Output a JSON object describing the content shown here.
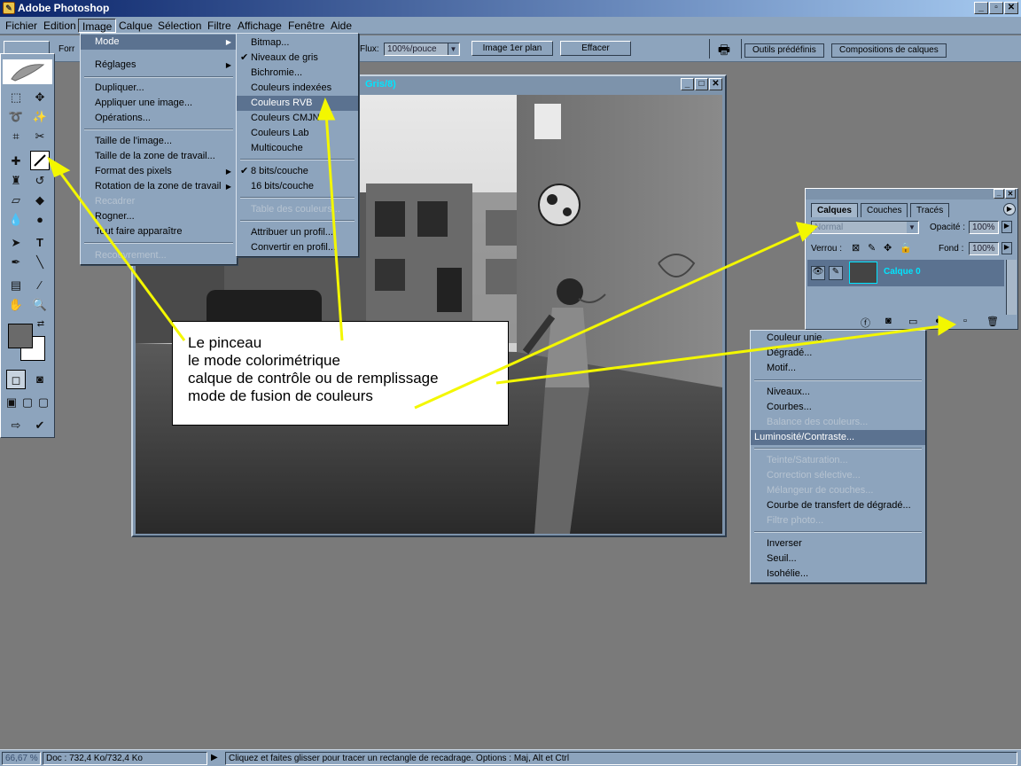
{
  "window": {
    "title": "Adobe Photoshop",
    "controls": [
      "_",
      "▫",
      "✕"
    ]
  },
  "menubar": {
    "items": [
      "Fichier",
      "Edition",
      "Image",
      "Calque",
      "Sélection",
      "Filtre",
      "Affichage",
      "Fenêtre",
      "Aide"
    ],
    "active": "Image"
  },
  "options_bar": {
    "left_label": "Forr",
    "flux_label": "Flux:",
    "flux_value": "100%/pouce",
    "front_image_button": "Image 1er plan",
    "clear_button": "Effacer",
    "palette_tabs": [
      "Outils prédéfinis",
      "Compositions de calques"
    ]
  },
  "document": {
    "title_fragment": "Gris/8)",
    "controls": [
      "_",
      "□",
      "✕"
    ]
  },
  "image_menu": {
    "items": [
      {
        "label": "Mode",
        "submenu": true,
        "highlighted": true
      },
      {
        "label": "Réglages",
        "submenu": true
      },
      {
        "label": "Dupliquer..."
      },
      {
        "label": "Appliquer une image..."
      },
      {
        "label": "Opérations..."
      },
      {
        "label": "Taille de l'image..."
      },
      {
        "label": "Taille de la zone de travail..."
      },
      {
        "label": "Format des pixels",
        "submenu": true
      },
      {
        "label": "Rotation de la zone de travail",
        "submenu": true
      },
      {
        "label": "Recadrer",
        "disabled": true
      },
      {
        "label": "Rogner..."
      },
      {
        "label": "Tout faire apparaître"
      },
      {
        "label": "Recouvrement...",
        "disabled": true
      }
    ]
  },
  "mode_submenu": {
    "items": [
      {
        "label": "Bitmap..."
      },
      {
        "label": "Niveaux de gris",
        "checked": true
      },
      {
        "label": "Bichromie..."
      },
      {
        "label": "Couleurs indexées"
      },
      {
        "label": "Couleurs RVB",
        "highlighted": true
      },
      {
        "label": "Couleurs CMJN"
      },
      {
        "label": "Couleurs Lab"
      },
      {
        "label": "Multicouche"
      },
      {
        "label": "8 bits/couche",
        "checked": true
      },
      {
        "label": "16 bits/couche"
      },
      {
        "label": "Table des couleurs...",
        "disabled": true
      },
      {
        "label": "Attribuer un profil..."
      },
      {
        "label": "Convertir en profil..."
      }
    ]
  },
  "layers_panel": {
    "tabs": [
      "Calques",
      "Couches",
      "Tracés"
    ],
    "active_tab": "Calques",
    "blend_mode": "Normal",
    "opacity_label": "Opacité :",
    "opacity_value": "100%",
    "lock_label": "Verrou :",
    "fill_label": "Fond :",
    "fill_value": "100%",
    "layer_name": "Calque 0"
  },
  "adjustment_menu": {
    "items": [
      {
        "label": "Couleur unie..."
      },
      {
        "label": "Dégradé..."
      },
      {
        "label": "Motif..."
      },
      {
        "label": "Niveaux..."
      },
      {
        "label": "Courbes..."
      },
      {
        "label": "Balance des couleurs...",
        "disabled": true
      },
      {
        "label": "Luminosité/Contraste...",
        "highlighted": true
      },
      {
        "label": "Teinte/Saturation...",
        "disabled": true
      },
      {
        "label": "Correction sélective...",
        "disabled": true
      },
      {
        "label": "Mélangeur de couches...",
        "disabled": true
      },
      {
        "label": "Courbe de transfert de dégradé..."
      },
      {
        "label": "Filtre photo...",
        "disabled": true
      },
      {
        "label": "Inverser"
      },
      {
        "label": "Seuil..."
      },
      {
        "label": "Isohélie..."
      }
    ]
  },
  "callout": {
    "lines": [
      "Le pinceau",
      "le mode colorimétrique",
      "calque de contrôle ou de remplissage",
      "mode de fusion de couleurs"
    ]
  },
  "status_bar": {
    "zoom": "66,67 %",
    "doc_info": "Doc : 732,4 Ko/732,4 Ko",
    "hint": "Cliquez et faites glisser pour tracer un rectangle de recadrage. Options : Maj, Alt et Ctrl"
  },
  "colors": {
    "ui_blue": "#8da4bd",
    "highlight": "#5b7290",
    "annotation_arrow": "#f3f700",
    "doc_title_cyan": "#00e5ff"
  }
}
